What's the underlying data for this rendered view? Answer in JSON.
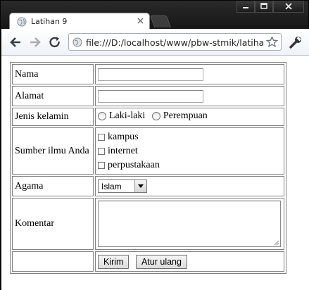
{
  "window": {
    "tab_title": "Latihan 9",
    "url": "file:///D:/localhost/www/pbw-stmik/latihan"
  },
  "form": {
    "nama": {
      "label": "Nama",
      "value": ""
    },
    "alamat": {
      "label": "Alamat",
      "value": ""
    },
    "jenis_kelamin": {
      "label": "Jenis kelamin",
      "options": [
        "Laki-laki",
        "Perempuan"
      ]
    },
    "sumber": {
      "label": "Sumber ilmu Anda",
      "options": [
        "kampus",
        "internet",
        "perpustakaan"
      ]
    },
    "agama": {
      "label": "Agama",
      "selected": "Islam"
    },
    "komentar": {
      "label": "Komentar",
      "value": ""
    },
    "buttons": {
      "submit": "Kirim",
      "reset": "Atur ulang"
    }
  }
}
